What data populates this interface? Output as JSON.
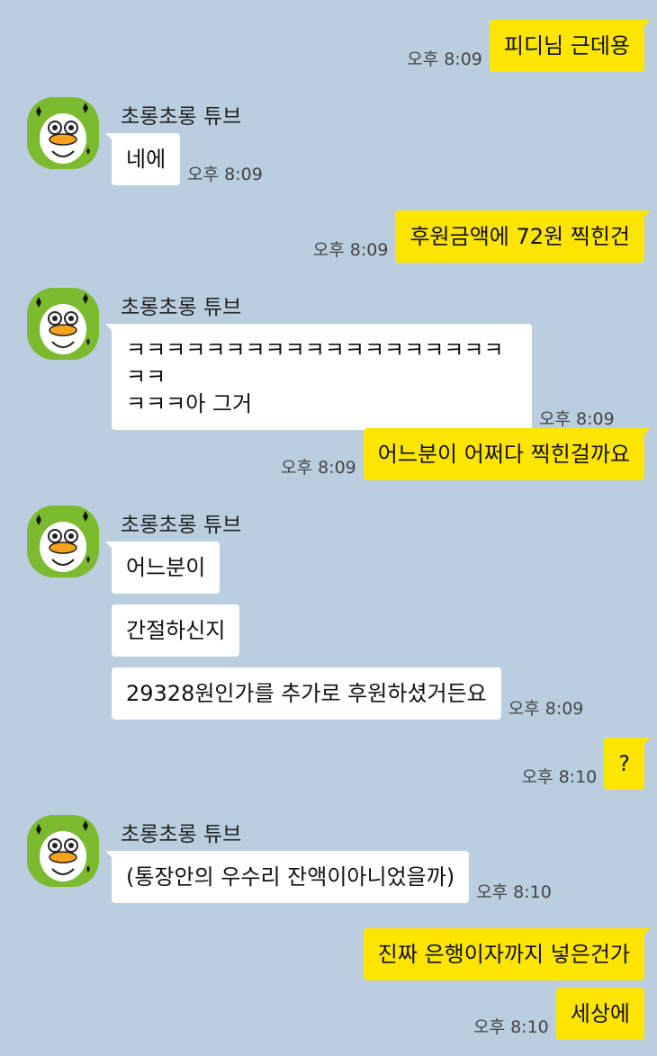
{
  "colors": {
    "background": "#bacee0",
    "outgoing": "#fee500",
    "incoming": "#ffffff",
    "timestamp": "#444444",
    "avatar": "#7cba2f"
  },
  "avatar_icon": "duck-icon",
  "messages": [
    {
      "dir": "out",
      "text": "피디님 근데용",
      "time": "오후 8:09"
    },
    {
      "dir": "in",
      "sender": "초롱초롱 튜브",
      "bubbles": [
        {
          "text": "네에",
          "time": "오후 8:09"
        }
      ]
    },
    {
      "dir": "out",
      "text": "후원금액에 72원 찍힌건",
      "time": "오후 8:09"
    },
    {
      "dir": "in",
      "sender": "초롱초롱 튜브",
      "bubbles": [
        {
          "text": "ㅋㅋㅋㅋㅋㅋㅋㅋㅋㅋㅋㅋㅋㅋㅋㅋㅋㅋㅋㅋㅋ\nㅋㅋㅋ아 그거",
          "time": "오후 8:09"
        }
      ]
    },
    {
      "dir": "out",
      "text": "어느분이 어쩌다 찍힌걸까요",
      "time": "오후 8:09"
    },
    {
      "dir": "in",
      "sender": "초롱초롱 튜브",
      "bubbles": [
        {
          "text": "어느분이"
        },
        {
          "text": "간절하신지"
        },
        {
          "text": "29328원인가를 추가로 후원하셨거든요",
          "time": "오후 8:09"
        }
      ]
    },
    {
      "dir": "out",
      "text": "?",
      "time": "오후 8:10"
    },
    {
      "dir": "in",
      "sender": "초롱초롱 튜브",
      "bubbles": [
        {
          "text": "(통장안의 우수리 잔액이아니었을까)",
          "time": "오후 8:10"
        }
      ]
    },
    {
      "dir": "out",
      "text": "진짜 은행이자까지 넣은건가"
    },
    {
      "dir": "out",
      "text": "세상에",
      "time": "오후 8:10",
      "continued": true
    }
  ]
}
